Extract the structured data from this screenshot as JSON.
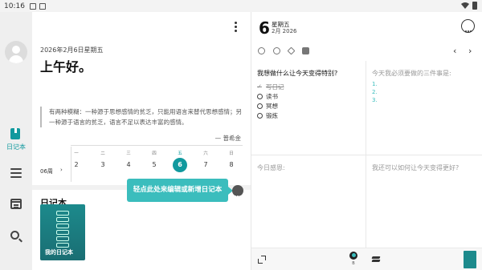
{
  "status": {
    "time": "10:16"
  },
  "nav": {
    "journal_label": "日记本"
  },
  "header": {
    "date": "2026年2月6日星期五",
    "greeting": "上午好。"
  },
  "quote": {
    "text": "有两种模糊：一种源于思想感情的贫乏，只能用语言来替代思想感情；另一种源于语言的贫乏，语言不足以表达丰富的感情。",
    "author": "— 普希金"
  },
  "week": {
    "label": "06周",
    "days": [
      {
        "name": "一",
        "num": "2"
      },
      {
        "name": "二",
        "num": "3"
      },
      {
        "name": "三",
        "num": "4"
      },
      {
        "name": "四",
        "num": "5"
      },
      {
        "name": "五",
        "num": "6"
      },
      {
        "name": "六",
        "num": "7"
      },
      {
        "name": "日",
        "num": "8"
      }
    ]
  },
  "journal": {
    "title": "日记本",
    "tooltip": "轻点此处来编辑或新增日记本",
    "book_name": "我的日记本"
  },
  "right": {
    "day": "6",
    "weekday": "星期五",
    "month_year": "2月 2026",
    "q1_title": "我想做什么让今天变得特别?",
    "q1_items": [
      "写日记",
      "读书",
      "冥想",
      "锻炼"
    ],
    "q2_title": "今天我必须要做的三件事是:",
    "q2_nums": [
      "1.",
      "2.",
      "3."
    ],
    "q3_title": "今日感恩:",
    "q4_title": "我还可以如何让今天变得更好?",
    "mood_label": "B"
  },
  "colors": {
    "accent": "#11999e",
    "tooltip": "#3bbdbd"
  }
}
